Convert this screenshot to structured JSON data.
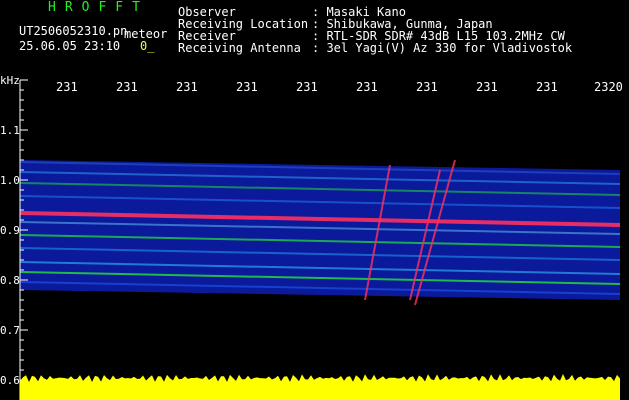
{
  "header": {
    "title": "HROFFT",
    "filename": "UT2506052310.pn",
    "meteor_label": "meteor",
    "datetime": "25.06.05 23:10",
    "marker": "0_"
  },
  "info": [
    {
      "label": "Observer",
      "value": ": Masaki Kano"
    },
    {
      "label": "Receiving Location",
      "value": ": Shibukawa, Gunma, Japan"
    },
    {
      "label": "Receiver",
      "value": ": RTL-SDR SDR# 43dB L15 103.2MHz CW"
    },
    {
      "label": "Receiving Antenna",
      "value": ": 3el Yagi(V) Az 330 for Vladivostok"
    }
  ],
  "x_axis_labels": [
    "231",
    "231",
    "231",
    "231",
    "231",
    "231",
    "231",
    "231",
    "231",
    "2320"
  ],
  "y_axis": {
    "unit": "kHz",
    "labels": [
      "1.1",
      "1.0",
      "0.9",
      "0.8",
      "0.7",
      "0.6"
    ]
  },
  "colors": {
    "trace": "#ffff00",
    "signal_hot": "#ff3060",
    "signal_mid": "#22cc44",
    "background_noise": "#0a1a9a"
  }
}
